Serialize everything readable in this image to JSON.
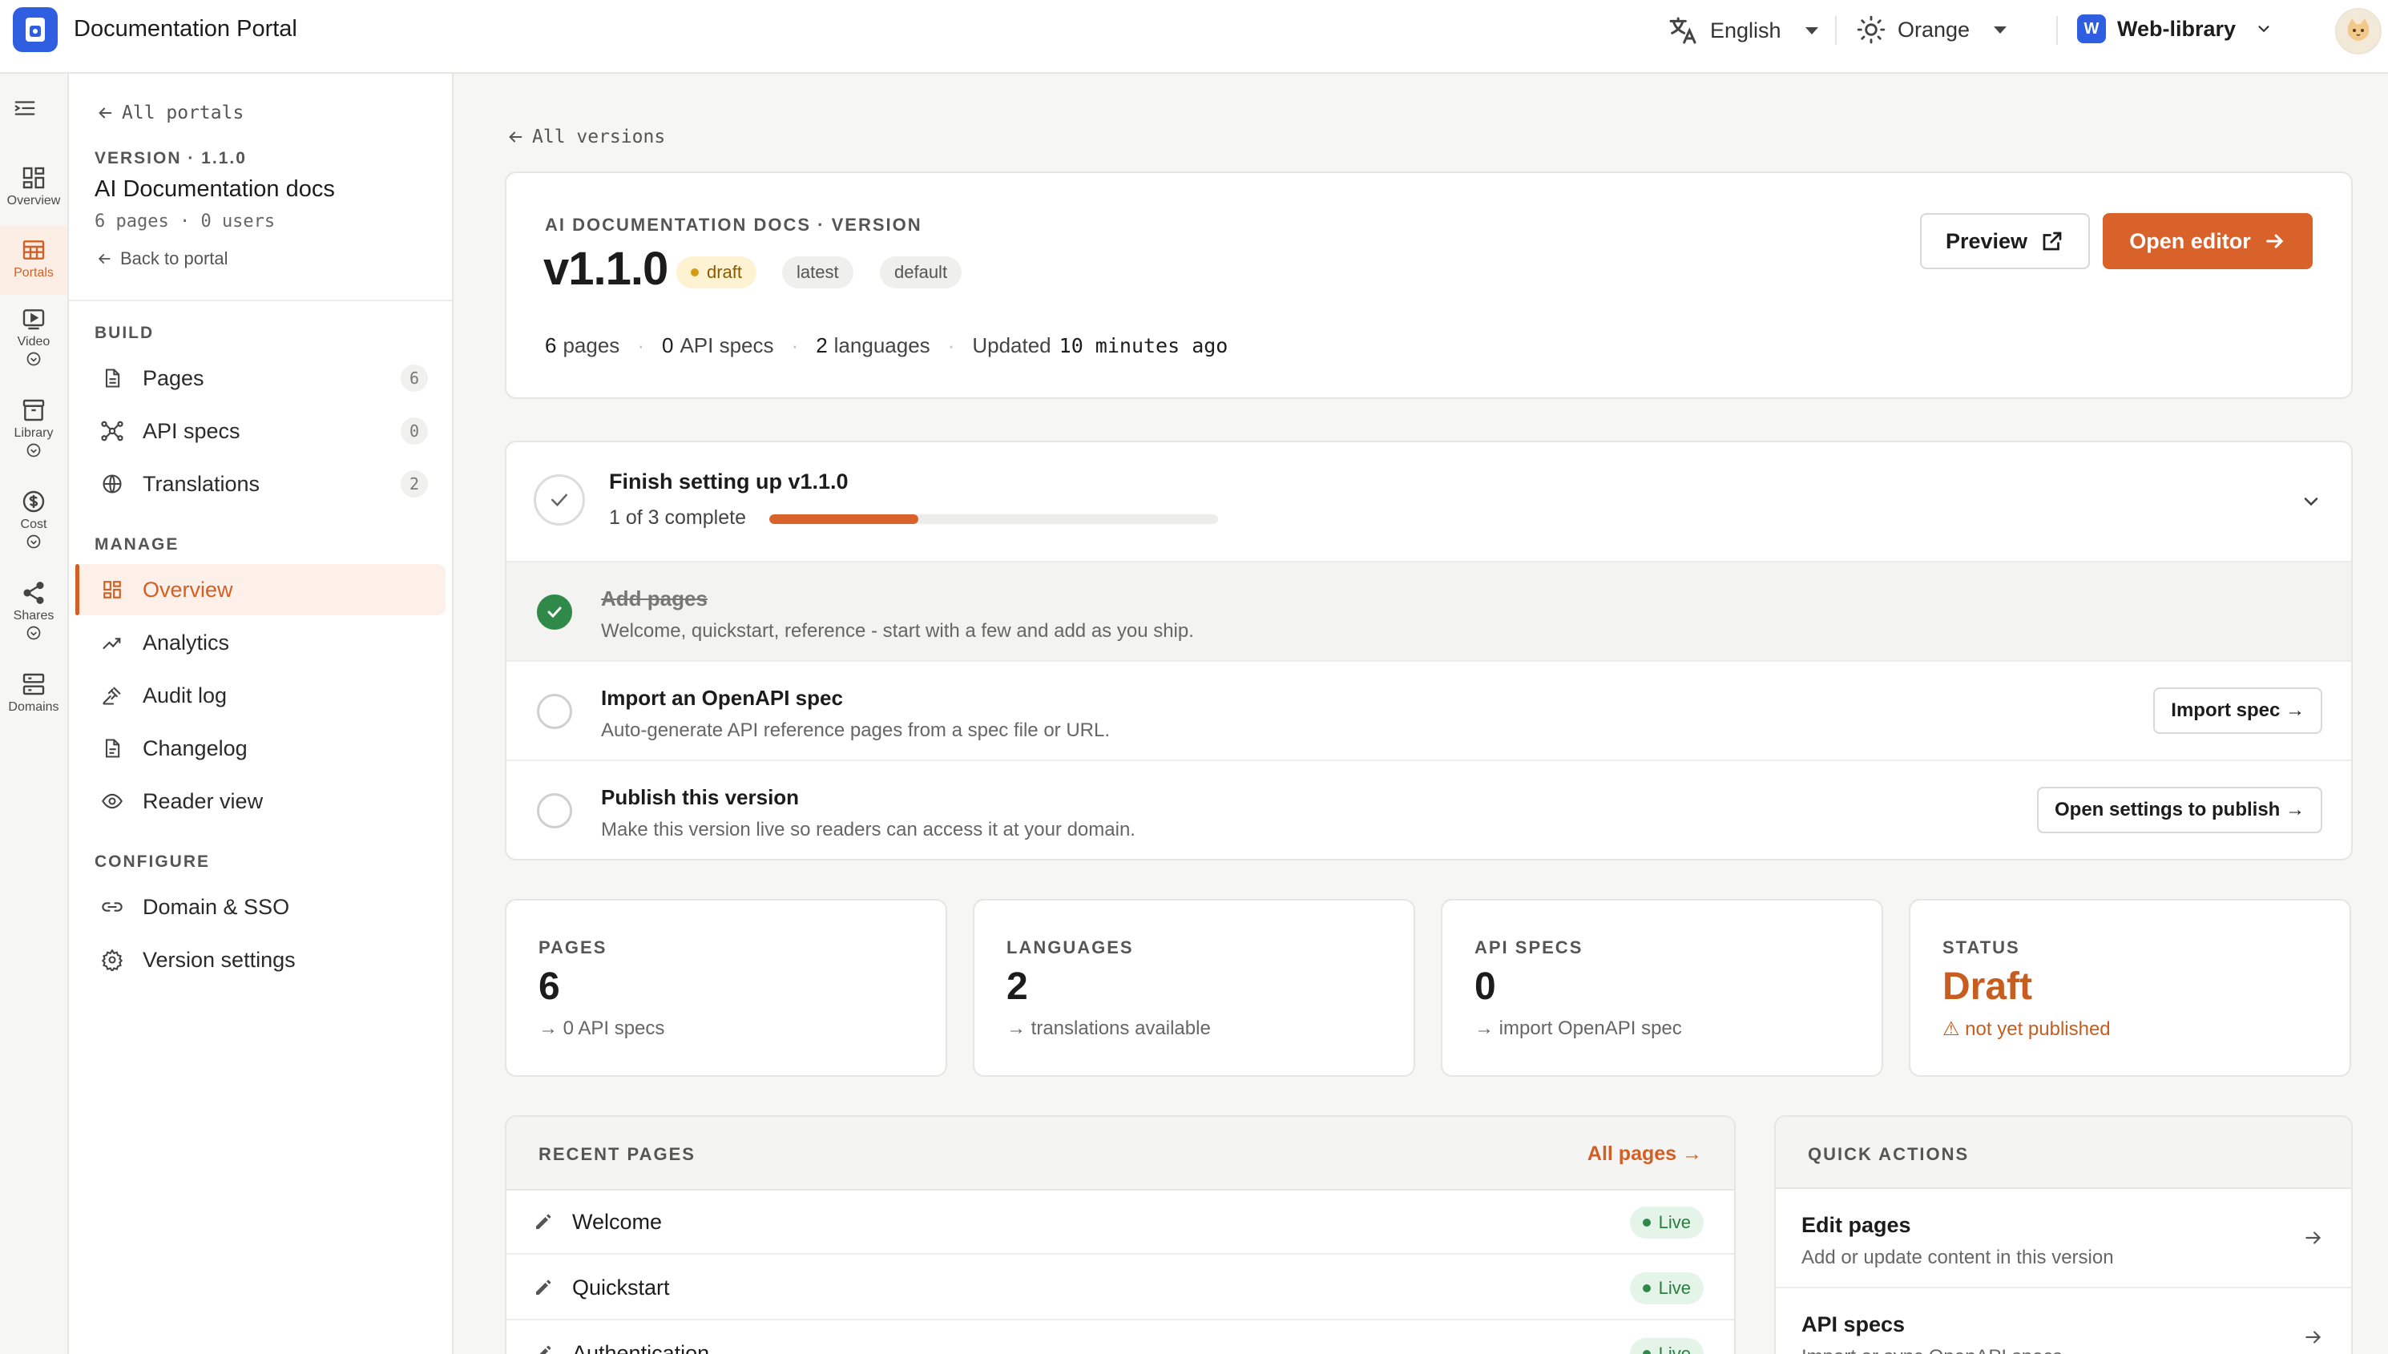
{
  "app": {
    "title": "Documentation Portal"
  },
  "topbar": {
    "language": "English",
    "theme": "Orange",
    "workspace_initial": "W",
    "workspace": "Web-library"
  },
  "rail": {
    "items": [
      {
        "label": "Overview",
        "icon": "grid-icon"
      },
      {
        "label": "Portals",
        "icon": "table-icon",
        "active": true
      },
      {
        "label": "Video",
        "icon": "play-icon"
      },
      {
        "label": "Library",
        "icon": "archive-icon"
      },
      {
        "label": "Cost",
        "icon": "dollar-icon"
      },
      {
        "label": "Shares",
        "icon": "share-icon"
      },
      {
        "label": "Domains",
        "icon": "server-icon"
      }
    ]
  },
  "sidebar": {
    "back_label": "All portals",
    "eyebrow": "VERSION · 1.1.0",
    "title": "AI Documentation docs",
    "meta": "6 pages · 0 users",
    "back_to_portal": "Back to portal",
    "sections": {
      "build": "BUILD",
      "manage": "MANAGE",
      "configure": "CONFIGURE"
    },
    "build_items": [
      {
        "label": "Pages",
        "count": "6"
      },
      {
        "label": "API specs",
        "count": "0"
      },
      {
        "label": "Translations",
        "count": "2"
      }
    ],
    "manage_items": [
      {
        "label": "Overview",
        "active": true
      },
      {
        "label": "Analytics"
      },
      {
        "label": "Audit log"
      },
      {
        "label": "Changelog"
      },
      {
        "label": "Reader view"
      }
    ],
    "configure_items": [
      {
        "label": "Domain & SSO"
      },
      {
        "label": "Version settings"
      }
    ]
  },
  "main": {
    "back_label": "All versions",
    "hero": {
      "eyebrow": "AI DOCUMENTATION DOCS · VERSION",
      "version": "v1.1.0",
      "badges": {
        "draft": "draft",
        "latest": "latest",
        "default": "default"
      },
      "stats": {
        "pages_num": "6",
        "pages_label": "pages",
        "specs_num": "0",
        "specs_label": "API specs",
        "lang_num": "2",
        "lang_label": "languages",
        "updated_label": "Updated",
        "updated_value": "10 minutes ago"
      },
      "preview_label": "Preview",
      "open_editor_label": "Open editor"
    },
    "setup": {
      "title": "Finish setting up v1.1.0",
      "progress_done": "1",
      "progress_of": "of",
      "progress_total": "3",
      "progress_suffix": "complete",
      "progress_fraction": 0.333,
      "tasks": [
        {
          "title": "Add pages",
          "desc": "Welcome, quickstart, reference - start with a few and add as you ship.",
          "done": true
        },
        {
          "title": "Import an OpenAPI spec",
          "desc": "Auto-generate API reference pages from a spec file or URL.",
          "button": "Import spec →"
        },
        {
          "title": "Publish this version",
          "desc": "Make this version live so readers can access it at your domain.",
          "button": "Open settings to publish →"
        }
      ]
    },
    "stats": [
      {
        "label": "PAGES",
        "value": "6",
        "sub": "→ 0 API specs"
      },
      {
        "label": "LANGUAGES",
        "value": "2",
        "sub": "→ translations available"
      },
      {
        "label": "API SPECS",
        "value": "0",
        "sub": "→ import OpenAPI spec"
      },
      {
        "label": "STATUS",
        "value": "Draft",
        "sub": "⚠ not yet published"
      }
    ],
    "recent_pages": {
      "label": "RECENT PAGES",
      "link": "All pages →",
      "rows": [
        {
          "name": "Welcome",
          "status": "Live"
        },
        {
          "name": "Quickstart",
          "status": "Live"
        },
        {
          "name": "Authentication",
          "status": "Live"
        }
      ]
    },
    "quick_actions": {
      "label": "QUICK ACTIONS",
      "rows": [
        {
          "title": "Edit pages",
          "desc": "Add or update content in this version"
        },
        {
          "title": "API specs",
          "desc": "Import or sync OpenAPI specs"
        }
      ]
    }
  },
  "colors": {
    "accent": "#d9622b",
    "brand_blue": "#2f5fe0",
    "success": "#2f8a4a",
    "draft_text": "#c75d1e"
  }
}
